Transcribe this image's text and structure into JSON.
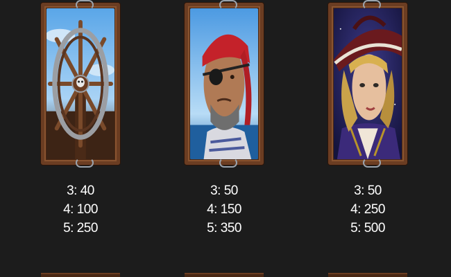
{
  "symbols": [
    {
      "icon": "ship-wheel-icon",
      "payouts": {
        "three": "3: 40",
        "four": "4: 100",
        "five": "5: 250"
      }
    },
    {
      "icon": "pirate-eyepatch-icon",
      "payouts": {
        "three": "3: 50",
        "four": "4: 150",
        "five": "5: 350"
      }
    },
    {
      "icon": "female-pirate-icon",
      "payouts": {
        "three": "3: 50",
        "four": "4: 250",
        "five": "5: 500"
      }
    }
  ],
  "colors": {
    "background": "#1c1c1c",
    "frame_wood": "#6b3d22",
    "frame_ornament": "#9aa3ad",
    "text": "#ffffff"
  }
}
